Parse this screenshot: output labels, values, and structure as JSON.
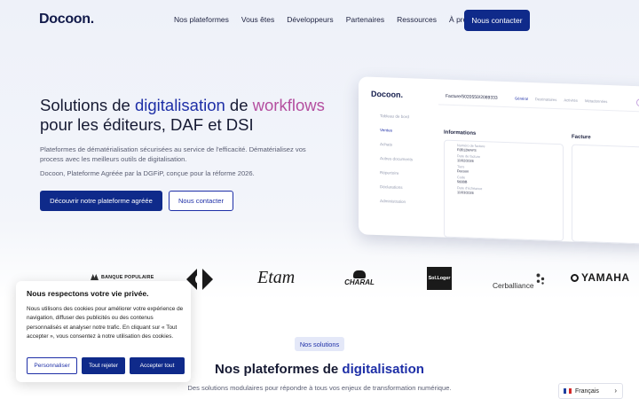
{
  "header": {
    "logo": "Docoon.",
    "nav": [
      "Nos plateformes",
      "Vous êtes",
      "Développeurs",
      "Partenaires",
      "Ressources",
      "À propos"
    ],
    "contact_button": "Nous contacter"
  },
  "hero": {
    "title_part1": "Solutions de ",
    "title_blue": "digitalisation",
    "title_part2": " de ",
    "title_pink": "workflows",
    "title_line2": "pour les éditeurs, DAF et DSI",
    "paragraph1": "Plateformes de dématérialisation sécurisées au service de l'efficacité. Dématérialisez vos process avec les meilleurs outils de digitalisation.",
    "paragraph2": "Docoon, Plateforme Agréée par la DGFiP, conçue pour la réforme 2026.",
    "primary_button": "Découvrir notre plateforme agréée",
    "secondary_button": "Nous contacter"
  },
  "mockup": {
    "logo": "Docoon.",
    "invoice_title": "Facture/5020550/2089333",
    "tabs": [
      "Général",
      "Destinataires",
      "Activités",
      "Métadonnées"
    ],
    "sidebar": [
      "Tableau de bord",
      "Ventes",
      "Achats",
      "Autres documents",
      "Répertoire",
      "Déclarations",
      "Administration"
    ],
    "section_info": "Informations",
    "section_invoice": "Facture",
    "fields": [
      "Numéro de facture",
      "F0B12MAYS",
      "Date de facture",
      "11/02/2026",
      "Tiers",
      "Docoon",
      "Code",
      "560BB",
      "Date d'échéance",
      "11/03/2026"
    ]
  },
  "logos": [
    "BANQUE POPULAIRE",
    "Carrefour",
    "Etam",
    "CHARAL",
    "Sol.Loger",
    "Cerballiance",
    "YAMAHA"
  ],
  "cookie": {
    "title": "Nous respectons votre vie privée.",
    "text": "Nous utilisons des cookies pour améliorer votre expérience de navigation, diffuser des publicités ou des contenus personnalisés et analyser notre trafic. En cliquant sur « Tout accepter », vous consentez à notre utilisation des cookies.",
    "customize": "Personnaliser",
    "reject": "Tout rejeter",
    "accept": "Accepter tout"
  },
  "solutions": {
    "badge": "Nos solutions",
    "title_part1": "Nos plateformes de ",
    "title_blue": "digitalisation",
    "subtitle": "Des solutions modulaires pour répondre à tous vos enjeux de transformation numérique."
  },
  "language": {
    "label": "Français"
  },
  "colors": {
    "primary": "#0f2a8a",
    "accent_blue": "#1e2fa7",
    "accent_pink": "#b44fa0"
  }
}
